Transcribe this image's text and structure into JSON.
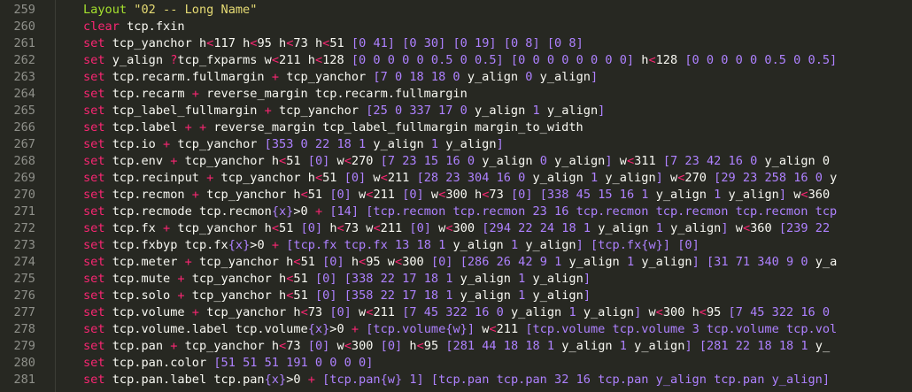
{
  "lines": [
    {
      "n": "259",
      "t": [
        [
          "lay",
          "Layout "
        ],
        [
          "str",
          "\"02 -- Long Name\""
        ]
      ]
    },
    {
      "n": "260",
      "t": [
        [
          "kw",
          "clear "
        ],
        [
          "plain",
          "tcp.fxin"
        ]
      ]
    },
    {
      "n": "261",
      "t": [
        [
          "kw",
          "set "
        ],
        [
          "plain",
          "tcp_yanchor "
        ],
        [
          "plain",
          "h"
        ],
        [
          "cmp",
          "<"
        ],
        [
          "plain",
          "117 h"
        ],
        [
          "cmp",
          "<"
        ],
        [
          "plain",
          "95 h"
        ],
        [
          "cmp",
          "<"
        ],
        [
          "plain",
          "73 h"
        ],
        [
          "cmp",
          "<"
        ],
        [
          "plain",
          "51 "
        ],
        [
          "br",
          "[0 41] [0 30] [0 19] [0 8] [0 8]"
        ]
      ]
    },
    {
      "n": "262",
      "t": [
        [
          "kw",
          "set "
        ],
        [
          "plain",
          "y_align "
        ],
        [
          "kw",
          "?"
        ],
        [
          "plain",
          "tcp_fxparms w"
        ],
        [
          "cmp",
          "<"
        ],
        [
          "plain",
          "211 h"
        ],
        [
          "cmp",
          "<"
        ],
        [
          "plain",
          "128 "
        ],
        [
          "br",
          "[0 0 0 0 0 0.5 0 0.5] [0 0 0 0 0 0 0 0]"
        ],
        [
          "plain",
          " h"
        ],
        [
          "cmp",
          "<"
        ],
        [
          "plain",
          "128 "
        ],
        [
          "br",
          "[0 0 0 0 0 0.5 0 0.5]"
        ]
      ]
    },
    {
      "n": "263",
      "t": [
        [
          "kw",
          "set "
        ],
        [
          "plain",
          "tcp.recarm.fullmargin "
        ],
        [
          "op",
          "+ "
        ],
        [
          "plain",
          "tcp_yanchor "
        ],
        [
          "br",
          "[7 0 18 18 0 "
        ],
        [
          "plain",
          "y_align "
        ],
        [
          "br",
          "0 "
        ],
        [
          "plain",
          "y_align"
        ],
        [
          "br",
          "]"
        ]
      ]
    },
    {
      "n": "264",
      "t": [
        [
          "kw",
          "set "
        ],
        [
          "plain",
          "tcp.recarm "
        ],
        [
          "op",
          "+ "
        ],
        [
          "plain",
          "reverse_margin tcp.recarm.fullmargin"
        ]
      ]
    },
    {
      "n": "265",
      "t": [
        [
          "kw",
          "set "
        ],
        [
          "plain",
          "tcp_label_fullmargin "
        ],
        [
          "op",
          "+ "
        ],
        [
          "plain",
          "tcp_yanchor "
        ],
        [
          "br",
          "[25 0 337 17 0 "
        ],
        [
          "plain",
          "y_align "
        ],
        [
          "br",
          "1 "
        ],
        [
          "plain",
          "y_align"
        ],
        [
          "br",
          "]"
        ]
      ]
    },
    {
      "n": "266",
      "t": [
        [
          "kw",
          "set "
        ],
        [
          "plain",
          "tcp.label "
        ],
        [
          "op",
          "+ + "
        ],
        [
          "plain",
          "reverse_margin tcp_label_fullmargin margin_to_width"
        ]
      ]
    },
    {
      "n": "267",
      "t": [
        [
          "kw",
          "set "
        ],
        [
          "plain",
          "tcp.io "
        ],
        [
          "op",
          "+ "
        ],
        [
          "plain",
          "tcp_yanchor "
        ],
        [
          "br",
          "[353 0 22 18 1 "
        ],
        [
          "plain",
          "y_align "
        ],
        [
          "br",
          "1 "
        ],
        [
          "plain",
          "y_align"
        ],
        [
          "br",
          "]"
        ]
      ]
    },
    {
      "n": "268",
      "t": [
        [
          "kw",
          "set "
        ],
        [
          "plain",
          "tcp.env "
        ],
        [
          "op",
          "+ "
        ],
        [
          "plain",
          "tcp_yanchor h"
        ],
        [
          "cmp",
          "<"
        ],
        [
          "plain",
          "51 "
        ],
        [
          "br",
          "[0]"
        ],
        [
          "plain",
          " w"
        ],
        [
          "cmp",
          "<"
        ],
        [
          "plain",
          "270 "
        ],
        [
          "br",
          "[7 23 15 16 0 "
        ],
        [
          "plain",
          "y_align "
        ],
        [
          "br",
          "0 "
        ],
        [
          "plain",
          "y_align"
        ],
        [
          "br",
          "]"
        ],
        [
          "plain",
          " w"
        ],
        [
          "cmp",
          "<"
        ],
        [
          "plain",
          "311 "
        ],
        [
          "br",
          "[7 23 42 16 0 "
        ],
        [
          "plain",
          "y_align 0"
        ]
      ]
    },
    {
      "n": "269",
      "t": [
        [
          "kw",
          "set "
        ],
        [
          "plain",
          "tcp.recinput "
        ],
        [
          "op",
          "+ "
        ],
        [
          "plain",
          "tcp_yanchor h"
        ],
        [
          "cmp",
          "<"
        ],
        [
          "plain",
          "51 "
        ],
        [
          "br",
          "[0]"
        ],
        [
          "plain",
          " w"
        ],
        [
          "cmp",
          "<"
        ],
        [
          "plain",
          "211 "
        ],
        [
          "br",
          "[28 23 304 16 0 "
        ],
        [
          "plain",
          "y_align "
        ],
        [
          "br",
          "1 "
        ],
        [
          "plain",
          "y_align"
        ],
        [
          "br",
          "]"
        ],
        [
          "plain",
          " w"
        ],
        [
          "cmp",
          "<"
        ],
        [
          "plain",
          "270 "
        ],
        [
          "br",
          "[29 23 258 16 0 "
        ],
        [
          "plain",
          "y"
        ]
      ]
    },
    {
      "n": "270",
      "t": [
        [
          "kw",
          "set "
        ],
        [
          "plain",
          "tcp.recmon "
        ],
        [
          "op",
          "+ "
        ],
        [
          "plain",
          "tcp_yanchor h"
        ],
        [
          "cmp",
          "<"
        ],
        [
          "plain",
          "51 "
        ],
        [
          "br",
          "[0]"
        ],
        [
          "plain",
          " w"
        ],
        [
          "cmp",
          "<"
        ],
        [
          "plain",
          "211 "
        ],
        [
          "br",
          "[0]"
        ],
        [
          "plain",
          " w"
        ],
        [
          "cmp",
          "<"
        ],
        [
          "plain",
          "300 h"
        ],
        [
          "cmp",
          "<"
        ],
        [
          "plain",
          "73 "
        ],
        [
          "br",
          "[0]"
        ],
        [
          "plain",
          " "
        ],
        [
          "br",
          "[338 45 15 16 1 "
        ],
        [
          "plain",
          "y_align "
        ],
        [
          "br",
          "1 "
        ],
        [
          "plain",
          "y_align"
        ],
        [
          "br",
          "]"
        ],
        [
          "plain",
          " w"
        ],
        [
          "cmp",
          "<"
        ],
        [
          "plain",
          "360"
        ]
      ]
    },
    {
      "n": "271",
      "t": [
        [
          "kw",
          "set "
        ],
        [
          "plain",
          "tcp.recmode tcp.recmon"
        ],
        [
          "br",
          "{x}"
        ],
        [
          "plain",
          ">0 "
        ],
        [
          "op",
          "+ "
        ],
        [
          "br",
          "[14]"
        ],
        [
          "plain",
          " "
        ],
        [
          "br",
          "[tcp.recmon tcp.recmon 23 16 tcp.recmon tcp.recmon tcp.recmon tcp"
        ]
      ]
    },
    {
      "n": "272",
      "t": [
        [
          "kw",
          "set "
        ],
        [
          "plain",
          "tcp.fx "
        ],
        [
          "op",
          "+ "
        ],
        [
          "plain",
          "tcp_yanchor h"
        ],
        [
          "cmp",
          "<"
        ],
        [
          "plain",
          "51 "
        ],
        [
          "br",
          "[0]"
        ],
        [
          "plain",
          " h"
        ],
        [
          "cmp",
          "<"
        ],
        [
          "plain",
          "73 w"
        ],
        [
          "cmp",
          "<"
        ],
        [
          "plain",
          "211 "
        ],
        [
          "br",
          "[0]"
        ],
        [
          "plain",
          " w"
        ],
        [
          "cmp",
          "<"
        ],
        [
          "plain",
          "300 "
        ],
        [
          "br",
          "[294 22 24 18 1 "
        ],
        [
          "plain",
          "y_align "
        ],
        [
          "br",
          "1 "
        ],
        [
          "plain",
          "y_align"
        ],
        [
          "br",
          "]"
        ],
        [
          "plain",
          " w"
        ],
        [
          "cmp",
          "<"
        ],
        [
          "plain",
          "360 "
        ],
        [
          "br",
          "[239 22"
        ]
      ]
    },
    {
      "n": "273",
      "t": [
        [
          "kw",
          "set "
        ],
        [
          "plain",
          "tcp.fxbyp tcp.fx"
        ],
        [
          "br",
          "{x}"
        ],
        [
          "plain",
          ">0 "
        ],
        [
          "op",
          "+ "
        ],
        [
          "br",
          "[tcp.fx tcp.fx 13 18 1 "
        ],
        [
          "plain",
          "y_align "
        ],
        [
          "br",
          "1 "
        ],
        [
          "plain",
          "y_align"
        ],
        [
          "br",
          "]"
        ],
        [
          "plain",
          " "
        ],
        [
          "br",
          "[tcp.fx"
        ],
        [
          "br",
          "{w}"
        ],
        [
          "br",
          "]"
        ],
        [
          "plain",
          " "
        ],
        [
          "br",
          "[0]"
        ]
      ]
    },
    {
      "n": "274",
      "t": [
        [
          "kw",
          "set "
        ],
        [
          "plain",
          "tcp.meter "
        ],
        [
          "op",
          "+ "
        ],
        [
          "plain",
          "tcp_yanchor h"
        ],
        [
          "cmp",
          "<"
        ],
        [
          "plain",
          "51 "
        ],
        [
          "br",
          "[0]"
        ],
        [
          "plain",
          " h"
        ],
        [
          "cmp",
          "<"
        ],
        [
          "plain",
          "95 w"
        ],
        [
          "cmp",
          "<"
        ],
        [
          "plain",
          "300 "
        ],
        [
          "br",
          "[0]"
        ],
        [
          "plain",
          " "
        ],
        [
          "br",
          "[286 26 42 9 1 "
        ],
        [
          "plain",
          "y_align "
        ],
        [
          "br",
          "1 "
        ],
        [
          "plain",
          "y_align"
        ],
        [
          "br",
          "]"
        ],
        [
          "plain",
          " "
        ],
        [
          "br",
          "[31 71 340 9 0 "
        ],
        [
          "plain",
          "y_a"
        ]
      ]
    },
    {
      "n": "275",
      "t": [
        [
          "kw",
          "set "
        ],
        [
          "plain",
          "tcp.mute "
        ],
        [
          "op",
          "+ "
        ],
        [
          "plain",
          "tcp_yanchor h"
        ],
        [
          "cmp",
          "<"
        ],
        [
          "plain",
          "51 "
        ],
        [
          "br",
          "[0]"
        ],
        [
          "plain",
          " "
        ],
        [
          "br",
          "[338 22 17 18 1 "
        ],
        [
          "plain",
          "y_align "
        ],
        [
          "br",
          "1 "
        ],
        [
          "plain",
          "y_align"
        ],
        [
          "br",
          "]"
        ]
      ]
    },
    {
      "n": "276",
      "t": [
        [
          "kw",
          "set "
        ],
        [
          "plain",
          "tcp.solo "
        ],
        [
          "op",
          "+ "
        ],
        [
          "plain",
          "tcp_yanchor h"
        ],
        [
          "cmp",
          "<"
        ],
        [
          "plain",
          "51 "
        ],
        [
          "br",
          "[0]"
        ],
        [
          "plain",
          " "
        ],
        [
          "br",
          "[358 22 17 18 1 "
        ],
        [
          "plain",
          "y_align "
        ],
        [
          "br",
          "1 "
        ],
        [
          "plain",
          "y_align"
        ],
        [
          "br",
          "]"
        ]
      ]
    },
    {
      "n": "277",
      "t": [
        [
          "kw",
          "set "
        ],
        [
          "plain",
          "tcp.volume "
        ],
        [
          "op",
          "+ "
        ],
        [
          "plain",
          "tcp_yanchor h"
        ],
        [
          "cmp",
          "<"
        ],
        [
          "plain",
          "73 "
        ],
        [
          "br",
          "[0]"
        ],
        [
          "plain",
          " w"
        ],
        [
          "cmp",
          "<"
        ],
        [
          "plain",
          "211 "
        ],
        [
          "br",
          "[7 45 322 16 0 "
        ],
        [
          "plain",
          "y_align "
        ],
        [
          "br",
          "1 "
        ],
        [
          "plain",
          "y_align"
        ],
        [
          "br",
          "]"
        ],
        [
          "plain",
          " w"
        ],
        [
          "cmp",
          "<"
        ],
        [
          "plain",
          "300 h"
        ],
        [
          "cmp",
          "<"
        ],
        [
          "plain",
          "95 "
        ],
        [
          "br",
          "[7 45 322 16 0"
        ]
      ]
    },
    {
      "n": "278",
      "t": [
        [
          "kw",
          "set "
        ],
        [
          "plain",
          "tcp.volume.label tcp.volume"
        ],
        [
          "br",
          "{x}"
        ],
        [
          "plain",
          ">0 "
        ],
        [
          "op",
          "+ "
        ],
        [
          "br",
          "[tcp.volume"
        ],
        [
          "br",
          "{w}"
        ],
        [
          "br",
          "]"
        ],
        [
          "plain",
          " w"
        ],
        [
          "cmp",
          "<"
        ],
        [
          "plain",
          "211 "
        ],
        [
          "br",
          "[tcp.volume tcp.volume 3 tcp.volume tcp.vol"
        ]
      ]
    },
    {
      "n": "279",
      "t": [
        [
          "kw",
          "set "
        ],
        [
          "plain",
          "tcp.pan "
        ],
        [
          "op",
          "+ "
        ],
        [
          "plain",
          "tcp_yanchor h"
        ],
        [
          "cmp",
          "<"
        ],
        [
          "plain",
          "73 "
        ],
        [
          "br",
          "[0]"
        ],
        [
          "plain",
          " w"
        ],
        [
          "cmp",
          "<"
        ],
        [
          "plain",
          "300 "
        ],
        [
          "br",
          "[0]"
        ],
        [
          "plain",
          " h"
        ],
        [
          "cmp",
          "<"
        ],
        [
          "plain",
          "95 "
        ],
        [
          "br",
          "[281 44 18 18 1 "
        ],
        [
          "plain",
          "y_align "
        ],
        [
          "br",
          "1 "
        ],
        [
          "plain",
          "y_align"
        ],
        [
          "br",
          "]"
        ],
        [
          "plain",
          " "
        ],
        [
          "br",
          "[281 22 18 18 1 "
        ],
        [
          "plain",
          "y_"
        ]
      ]
    },
    {
      "n": "280",
      "t": [
        [
          "kw",
          "set "
        ],
        [
          "plain",
          "tcp.pan.color "
        ],
        [
          "br",
          "[51 51 51 191 0 0 0 0]"
        ]
      ]
    },
    {
      "n": "281",
      "t": [
        [
          "kw",
          "set "
        ],
        [
          "plain",
          "tcp.pan.label tcp.pan"
        ],
        [
          "br",
          "{x}"
        ],
        [
          "plain",
          ">0 "
        ],
        [
          "op",
          "+ "
        ],
        [
          "br",
          "[tcp.pan"
        ],
        [
          "br",
          "{w}"
        ],
        [
          "br",
          " 1]"
        ],
        [
          "plain",
          " "
        ],
        [
          "br",
          "[tcp.pan tcp.pan 32 16 tcp.pan y_align tcp.pan y_align]"
        ]
      ]
    }
  ],
  "colors": {
    "background": "#272822",
    "line_number": "#8f908a",
    "keyword": "#f92672",
    "string": "#e6db74",
    "layout": "#a6e22e",
    "bracket": "#ae81ff",
    "plain": "#f8f8f2"
  }
}
